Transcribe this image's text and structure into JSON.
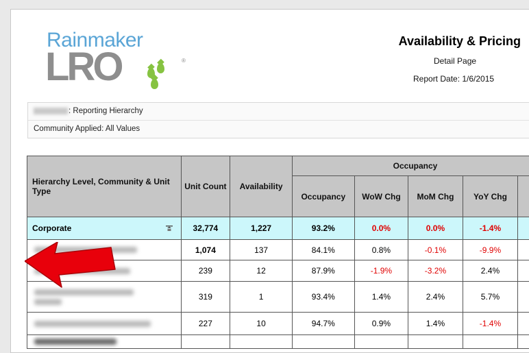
{
  "header": {
    "logo_top": "Rainmaker",
    "logo_bottom": "LRO",
    "logo_reg": "®",
    "title": "Availability & Pricing",
    "subtitle": "Detail Page",
    "report_date": "Report Date: 1/6/2015"
  },
  "filters": {
    "hierarchy_label": ": Reporting Hierarchy",
    "community_label": "Community Applied: All Values"
  },
  "table": {
    "col_hierarchy": "Hierarchy Level, Community & Unit Type",
    "col_unit_count": "Unit Count",
    "col_availability": "Availability",
    "group_occupancy": "Occupancy",
    "col_occupancy": "Occupancy",
    "col_wow": "WoW Chg",
    "col_mom": "MoM Chg",
    "col_yoy": "YoY Chg",
    "corporate": {
      "label": "Corporate",
      "unit_count": "32,774",
      "availability": "1,227",
      "occupancy": "93.2%",
      "wow": "0.0%",
      "mom": "0.0%",
      "yoy": "-1.4%"
    },
    "rows": [
      {
        "unit_count": "1,074",
        "availability": "137",
        "occupancy": "84.1%",
        "wow": "0.8%",
        "mom": "-0.1%",
        "yoy": "-9.9%"
      },
      {
        "unit_count": "239",
        "availability": "12",
        "occupancy": "87.9%",
        "wow": "-1.9%",
        "mom": "-3.2%",
        "yoy": "2.4%"
      },
      {
        "unit_count": "319",
        "availability": "1",
        "occupancy": "93.4%",
        "wow": "1.4%",
        "mom": "2.4%",
        "yoy": "5.7%"
      },
      {
        "unit_count": "227",
        "availability": "10",
        "occupancy": "94.7%",
        "wow": "0.9%",
        "mom": "1.4%",
        "yoy": "-1.4%"
      }
    ]
  },
  "colors": {
    "negative": "#e00000",
    "corporate_row": "#ccf7fb",
    "header_bg": "#c6c6c6",
    "arrow": "#e8000b",
    "logo_blue": "#5aa5d6",
    "logo_gray": "#8e8e8e",
    "logo_green": "#86c341"
  },
  "icons": {
    "sort": "sort-toggle-icon",
    "annotation": "red-arrow-annotation"
  }
}
